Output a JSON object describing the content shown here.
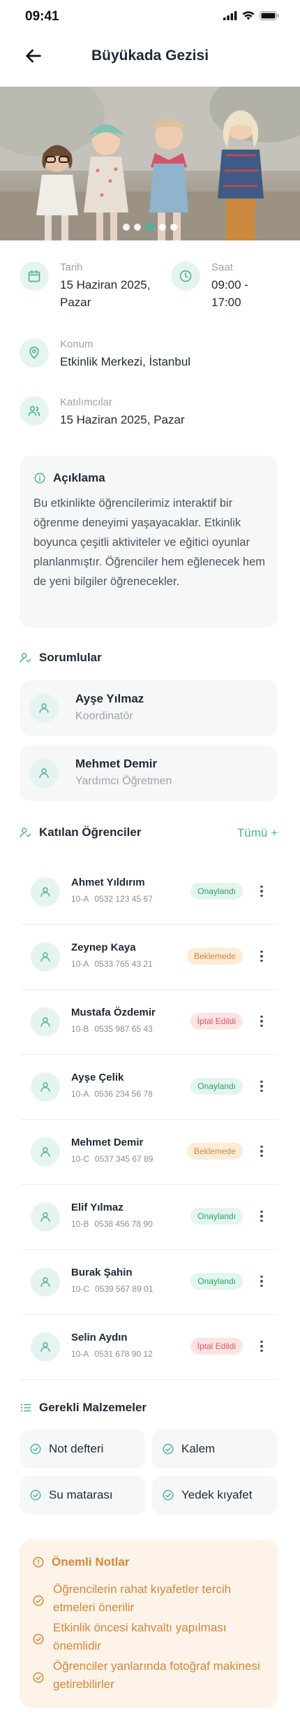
{
  "status_bar": {
    "time": "09:41"
  },
  "header": {
    "title": "Büyükada Gezisi"
  },
  "colors": {
    "accent": "#4fb39a",
    "approved": "#2fa36b",
    "pending": "#d4873a",
    "cancelled": "#e0545b"
  },
  "hero": {
    "slides": 5,
    "active_slide": 3
  },
  "info": {
    "date_label": "Tarih",
    "date_value": "15 Haziran 2025, Pazar",
    "time_label": "Saat",
    "time_value": "09:00 - 17:00",
    "location_label": "Konum",
    "location_value": "Etkinlik Merkezi, İstanbul",
    "participants_label": "Katılımcılar",
    "participants_value": "15 Haziran 2025, Pazar"
  },
  "description": {
    "title": "Açıklama",
    "text": "Bu etkinlikte öğrencilerimiz interaktif bir öğrenme deneyimi yaşayacaklar. Etkinlik boyunca çeşitli aktiviteler ve eğitici oyunlar planlanmıştır. Öğrenciler hem eğlenecek hem de yeni bilgiler öğrenecekler."
  },
  "responsibles": {
    "title": "Sorumlular",
    "items": [
      {
        "name": "Ayşe Yılmaz",
        "role": "Koordinatör"
      },
      {
        "name": "Mehmet Demir",
        "role": "Yardımcı Öğretmen"
      }
    ]
  },
  "students": {
    "title": "Katılan Öğrenciler",
    "all_label": "Tümü +",
    "items": [
      {
        "name": "Ahmet Yıldırım",
        "class": "10-A",
        "phone": "0532 123 45 67",
        "status": "Onaylandı",
        "status_type": "ok"
      },
      {
        "name": "Zeynep Kaya",
        "class": "10-A",
        "phone": "0533 765 43 21",
        "status": "Beklemede",
        "status_type": "wait"
      },
      {
        "name": "Mustafa Özdemir",
        "class": "10-B",
        "phone": "0535 987 65 43",
        "status": "İptal Edildi",
        "status_type": "cancel"
      },
      {
        "name": "Ayşe Çelik",
        "class": "10-A",
        "phone": "0536 234 56 78",
        "status": "Onaylandı",
        "status_type": "ok"
      },
      {
        "name": "Mehmet Demir",
        "class": "10-C",
        "phone": "0537 345 67 89",
        "status": "Beklemede",
        "status_type": "wait"
      },
      {
        "name": "Elif Yılmaz",
        "class": "10-B",
        "phone": "0538 456 78 90",
        "status": "Onaylandı",
        "status_type": "ok"
      },
      {
        "name": "Burak Şahin",
        "class": "10-C",
        "phone": "0539 567 89 01",
        "status": "Onaylandı",
        "status_type": "ok"
      },
      {
        "name": "Selin Aydın",
        "class": "10-A",
        "phone": "0531 678 90 12",
        "status": "İptal Edildi",
        "status_type": "cancel"
      }
    ]
  },
  "materials": {
    "title": "Gerekli Malzemeler",
    "items": [
      "Not defteri",
      "Kalem",
      "Su matarası",
      "Yedek kıyafet"
    ]
  },
  "notes": {
    "title": "Önemli Notlar",
    "items": [
      "Öğrencilerin rahat kıyafetler tercih etmeleri önerilir",
      "Etkinlik öncesi kahvaltı yapılması önemlidir",
      "Öğrenciler yanlarında fotoğraf makinesi getirebilirler"
    ]
  }
}
